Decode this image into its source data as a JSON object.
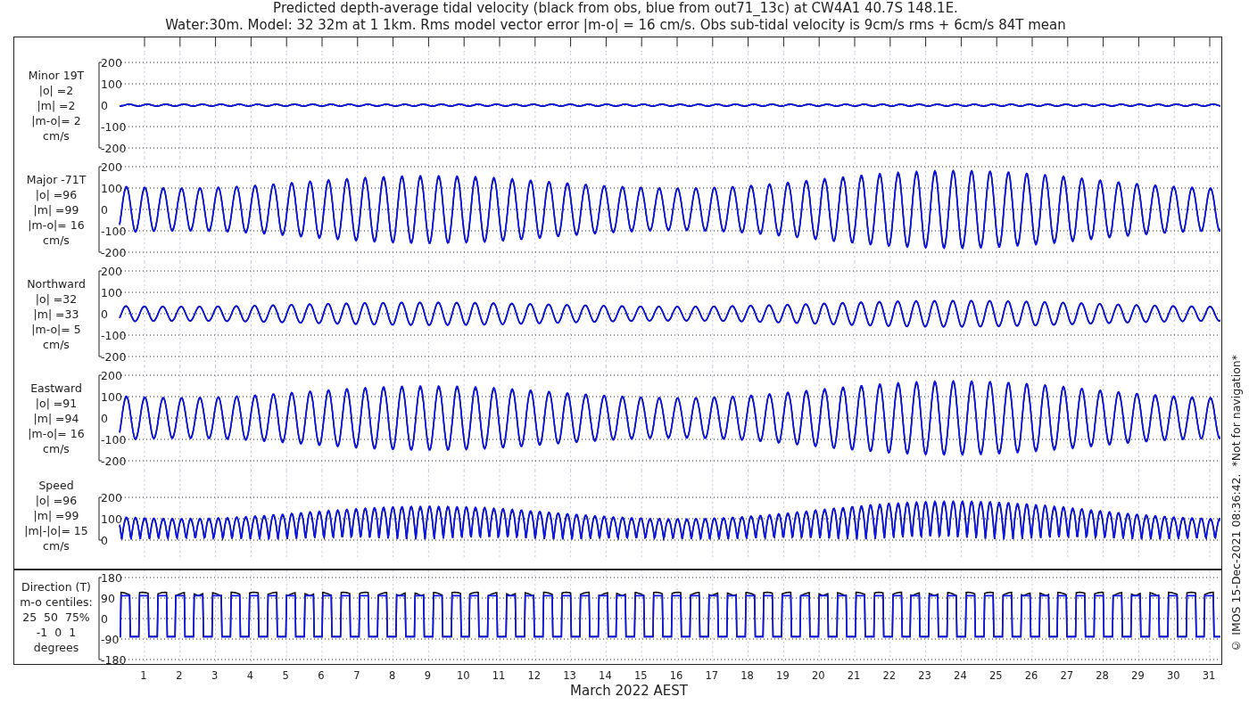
{
  "title_lines": [
    "Predicted depth-average tidal velocity (black from obs, blue from out71_13c) at CW4A1 40.7S 148.1E.",
    "Water:30m. Model: 32 32m at 1 1km. Rms model vector error |m-o| = 16 cm/s. Obs sub-tidal velocity is 9cm/s rms + 6cm/s 84T mean"
  ],
  "panels": [
    {
      "kind": "minor",
      "label_lines": [
        "Minor 19T",
        "|o| =2",
        "|m| =2",
        "|m-o|= 2",
        "cm/s"
      ],
      "ticks": [
        "200",
        "100",
        "0",
        "-100",
        "-200"
      ]
    },
    {
      "kind": "major",
      "label_lines": [
        "Major -71T",
        "|o| =96",
        "|m| =99",
        "|m-o|= 16",
        "cm/s"
      ],
      "ticks": [
        "200",
        "100",
        "0",
        "-100",
        "-200"
      ]
    },
    {
      "kind": "north",
      "label_lines": [
        "Northward",
        "|o| =32",
        "|m| =33",
        "|m-o|= 5",
        "cm/s"
      ],
      "ticks": [
        "200",
        "100",
        "0",
        "-100",
        "-200"
      ]
    },
    {
      "kind": "east",
      "label_lines": [
        "Eastward",
        "|o| =91",
        "|m| =94",
        "|m-o|= 16",
        "cm/s"
      ],
      "ticks": [
        "200",
        "100",
        "0",
        "-100",
        "-200"
      ]
    },
    {
      "kind": "speed",
      "label_lines": [
        "Speed",
        "|o| =96",
        "|m| =99",
        "|m|-|o|= 15",
        "cm/s"
      ],
      "ticks": [
        "200",
        "100",
        "0"
      ]
    }
  ],
  "direction_panel": {
    "kind": "direction",
    "label_lines": [
      "Direction (T)",
      "m-o centiles:",
      "25  50  75%",
      "-1  0  1",
      "degrees"
    ],
    "ticks": [
      "180",
      "90",
      "0",
      "-90",
      "-180"
    ]
  },
  "x_ticks": [
    "1",
    "2",
    "3",
    "4",
    "5",
    "6",
    "7",
    "8",
    "9",
    "10",
    "11",
    "12",
    "13",
    "14",
    "15",
    "16",
    "17",
    "18",
    "19",
    "20",
    "21",
    "22",
    "23",
    "24",
    "25",
    "26",
    "27",
    "28",
    "29",
    "30",
    "31"
  ],
  "x_label": "March 2022 AEST",
  "credit": "© IMOS 15-Dec-2021 08:36:42.  *Not for navigation*"
}
